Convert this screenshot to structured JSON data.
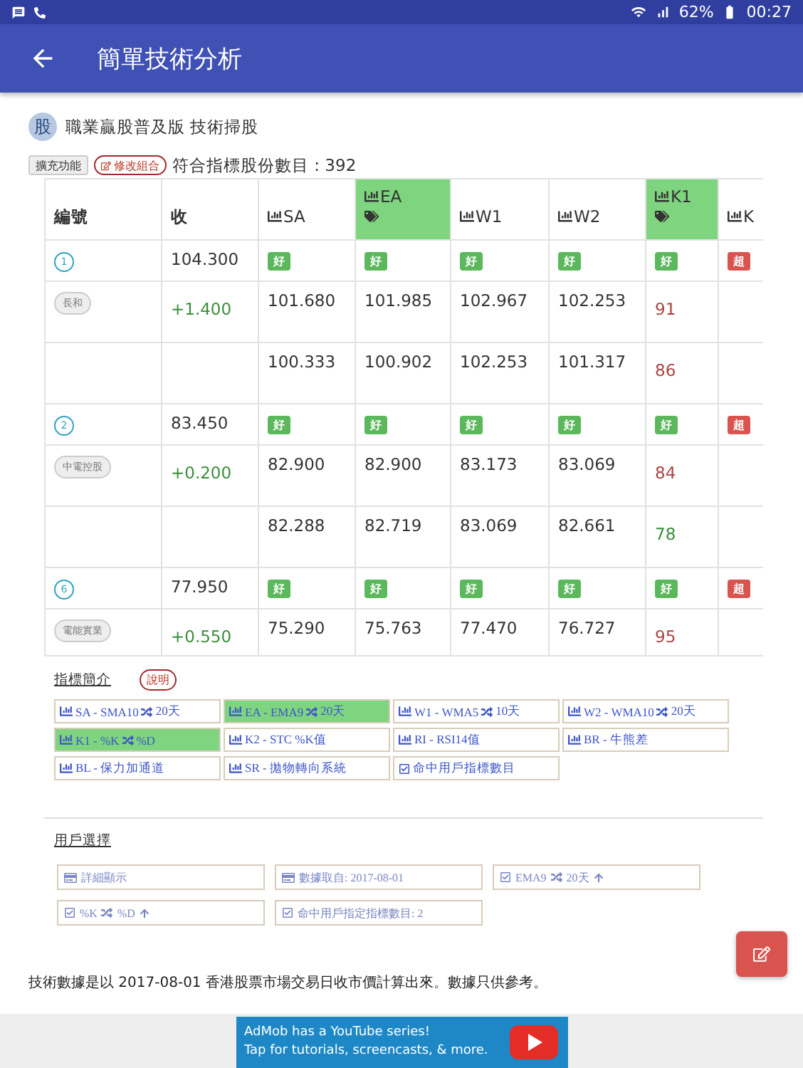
{
  "status_bar": {
    "battery": "62%",
    "time": "00:27"
  },
  "app_bar": {
    "title": "簡單技術分析"
  },
  "header": {
    "logo": "股",
    "title": "職業贏股普及版 技術掃股"
  },
  "toolbar": {
    "buttons": [
      {
        "label": "擴充功能",
        "kind": "plain"
      },
      {
        "label": "修改組合",
        "kind": "outline"
      }
    ],
    "count_text": "符合指標股份數目 : 392"
  },
  "table": {
    "columns": [
      {
        "label": "編號",
        "kind": "text",
        "highlighted": false
      },
      {
        "label": "收",
        "kind": "text",
        "highlighted": false
      },
      {
        "label": "SA",
        "kind": "indicator",
        "highlighted": false
      },
      {
        "label": "EA",
        "kind": "indicator",
        "highlighted": true
      },
      {
        "label": "W1",
        "kind": "indicator",
        "highlighted": false
      },
      {
        "label": "W2",
        "kind": "indicator",
        "highlighted": false
      },
      {
        "label": "K1",
        "kind": "indicator",
        "highlighted": true
      },
      {
        "label": "K",
        "kind": "indicator",
        "highlighted": false
      }
    ],
    "stocks": [
      {
        "number": "1",
        "name": "長和",
        "close": "104.300",
        "change": "+1.400",
        "badges": [
          {
            "text": "好",
            "color": "#5cb85c"
          },
          {
            "text": "好",
            "color": "#5cb85c"
          },
          {
            "text": "好",
            "color": "#5cb85c"
          },
          {
            "text": "好",
            "color": "#5cb85c"
          },
          {
            "text": "好",
            "color": "#5cb85c"
          },
          {
            "text": "超",
            "color": "#d9534f"
          }
        ],
        "value_rows": [
          {
            "values": [
              "101.680",
              "101.985",
              "102.967",
              "102.253"
            ],
            "k_value": "91",
            "color": "#a94442"
          },
          {
            "values": [
              "100.333",
              "100.902",
              "102.253",
              "101.317"
            ],
            "k_value": "86",
            "color": "#a94442"
          }
        ]
      },
      {
        "number": "2",
        "name": "中電控股",
        "close": "83.450",
        "change": "+0.200",
        "badges": [
          {
            "text": "好",
            "color": "#5cb85c"
          },
          {
            "text": "好",
            "color": "#5cb85c"
          },
          {
            "text": "好",
            "color": "#5cb85c"
          },
          {
            "text": "好",
            "color": "#5cb85c"
          },
          {
            "text": "好",
            "color": "#5cb85c"
          },
          {
            "text": "超",
            "color": "#d9534f"
          }
        ],
        "value_rows": [
          {
            "values": [
              "82.900",
              "82.900",
              "83.173",
              "83.069"
            ],
            "k_value": "84",
            "color": "#a94442"
          },
          {
            "values": [
              "82.288",
              "82.719",
              "83.069",
              "82.661"
            ],
            "k_value": "78",
            "color": "#3c8d3c"
          }
        ]
      },
      {
        "number": "6",
        "name": "電能實業",
        "close": "77.950",
        "change": "+0.550",
        "badges": [
          {
            "text": "好",
            "color": "#5cb85c"
          },
          {
            "text": "好",
            "color": "#5cb85c"
          },
          {
            "text": "好",
            "color": "#5cb85c"
          },
          {
            "text": "好",
            "color": "#5cb85c"
          },
          {
            "text": "好",
            "color": "#5cb85c"
          },
          {
            "text": "超",
            "color": "#d9534f"
          }
        ],
        "value_rows": [
          {
            "values": [
              "75.290",
              "75.763",
              "77.470",
              "76.727"
            ],
            "k_value": "95",
            "color": "#a94442"
          }
        ]
      }
    ]
  },
  "legend": {
    "title": "指標簡介",
    "help": "說明",
    "items": [
      {
        "kind": "chart",
        "text": "SA - SMA10",
        "pair": "20天",
        "highlighted": false
      },
      {
        "kind": "chart",
        "text": "EA - EMA9",
        "pair": "20天",
        "highlighted": true
      },
      {
        "kind": "chart",
        "text": "W1 - WMA5",
        "pair": "10天",
        "highlighted": false
      },
      {
        "kind": "chart",
        "text": "W2 - WMA10",
        "pair": "20天",
        "highlighted": false
      },
      {
        "kind": "chart",
        "text": "K1 - %K",
        "pair": "%D",
        "highlighted": true
      },
      {
        "kind": "chart",
        "text": "K2 - STC %K值",
        "highlighted": false
      },
      {
        "kind": "chart",
        "text": "RI - RSI14值",
        "highlighted": false
      },
      {
        "kind": "chart",
        "text": "BR - 牛熊差",
        "highlighted": false
      },
      {
        "kind": "chart",
        "text": "BL - 保力加通道",
        "highlighted": false
      },
      {
        "kind": "chart",
        "text": "SR - 拋物轉向系統",
        "highlighted": false
      },
      {
        "kind": "check",
        "text": "命中用戶指標數目",
        "highlighted": false
      }
    ]
  },
  "user_choice": {
    "title": "用戶選擇",
    "items": [
      {
        "kind": "card",
        "text": "詳細顯示",
        "up_arrow": false
      },
      {
        "kind": "card",
        "text": "數據取自: 2017-08-01",
        "up_arrow": false
      },
      {
        "kind": "check",
        "text": "EMA9",
        "pair": "20天",
        "up_arrow": true
      },
      {
        "kind": "check",
        "text": "%K",
        "pair": "%D",
        "up_arrow": true
      },
      {
        "kind": "check",
        "text": "命中用戶指定指標數目: 2",
        "up_arrow": false
      }
    ]
  },
  "footer_note": "技術數據是以 2017-08-01 香港股票市場交易日收市價計算出來。數據只供參考。",
  "ad": {
    "line_1": "AdMob has a YouTube series!",
    "line_2": "Tap for tutorials, screencasts, & more."
  }
}
